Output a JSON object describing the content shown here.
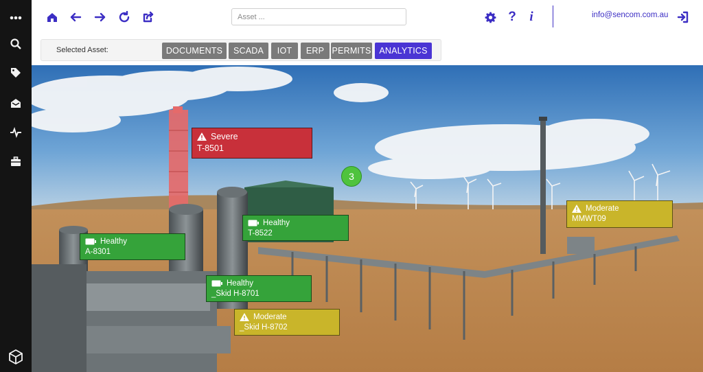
{
  "sidebar": {
    "items": [
      {
        "icon": "more-icon"
      },
      {
        "icon": "search-icon"
      },
      {
        "icon": "tag-icon"
      },
      {
        "icon": "inbox-icon"
      },
      {
        "icon": "pulse-icon"
      },
      {
        "icon": "toolbox-icon"
      }
    ],
    "logo_icon": "cube-logo-icon"
  },
  "toolbar": {
    "icons": [
      "home-icon",
      "back-arrow-icon",
      "forward-arrow-icon",
      "refresh-icon",
      "share-icon",
      "gear-icon",
      "help-icon",
      "info-icon",
      "logout-icon"
    ],
    "help_label": "?",
    "info_label": "i",
    "search_placeholder": "Asset ...",
    "email": "info@sencom.com.au",
    "accent_color": "#3c2ec4"
  },
  "assetbar": {
    "label": "Selected Asset:",
    "tabs": [
      {
        "label": "DOCUMENTS",
        "active": false
      },
      {
        "label": "SCADA",
        "active": false
      },
      {
        "label": "IOT",
        "active": false
      },
      {
        "label": "ERP",
        "active": false
      },
      {
        "label": "PERMITS",
        "active": false
      },
      {
        "label": "ANALYTICS",
        "active": true
      }
    ],
    "active_color": "#4a35d4"
  },
  "scene": {
    "cluster_count": "3",
    "tags": [
      {
        "status": "Severe",
        "name": "T-8501",
        "color": "#c8303a"
      },
      {
        "status": "Healthy",
        "name": "T-8522",
        "color": "#35a33a"
      },
      {
        "status": "Healthy",
        "name": "A-8301",
        "color": "#35a33a"
      },
      {
        "status": "Healthy",
        "name": "_Skid H-8701",
        "color": "#35a33a"
      },
      {
        "status": "Moderate",
        "name": "_Skid H-8702",
        "color": "#c9b52a"
      },
      {
        "status": "Moderate",
        "name": "MMWT09",
        "color": "#c9b52a"
      }
    ]
  }
}
